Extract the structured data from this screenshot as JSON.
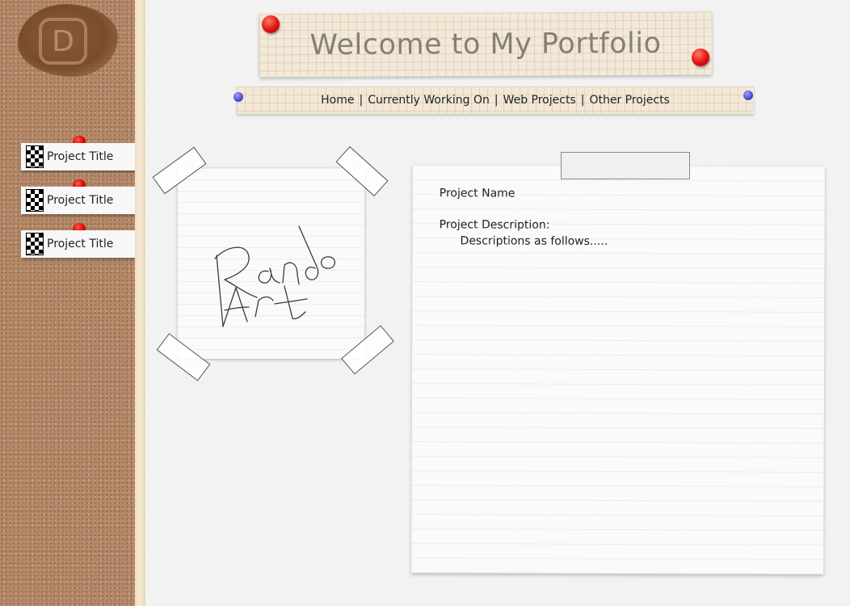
{
  "logo": {
    "letter": "D"
  },
  "sidebar": {
    "items": [
      {
        "label": "Project Title"
      },
      {
        "label": "Project Title"
      },
      {
        "label": "Project Title"
      }
    ]
  },
  "header": {
    "title": "Welcome to My Portfolio"
  },
  "nav": {
    "items": [
      {
        "label": "Home"
      },
      {
        "label": "Currently Working On"
      },
      {
        "label": "Web Projects"
      },
      {
        "label": "Other Projects"
      }
    ],
    "separator": "|"
  },
  "art_note": {
    "sketch_text": "Rando Art"
  },
  "details": {
    "project_name": "Project Name",
    "description_label": "Project Description:",
    "description_text": "Descriptions as follows....."
  },
  "colors": {
    "cork": "#b4896a",
    "pin_red": "#e00000",
    "pin_blue": "#4a4ad0",
    "title_text": "#858070"
  }
}
